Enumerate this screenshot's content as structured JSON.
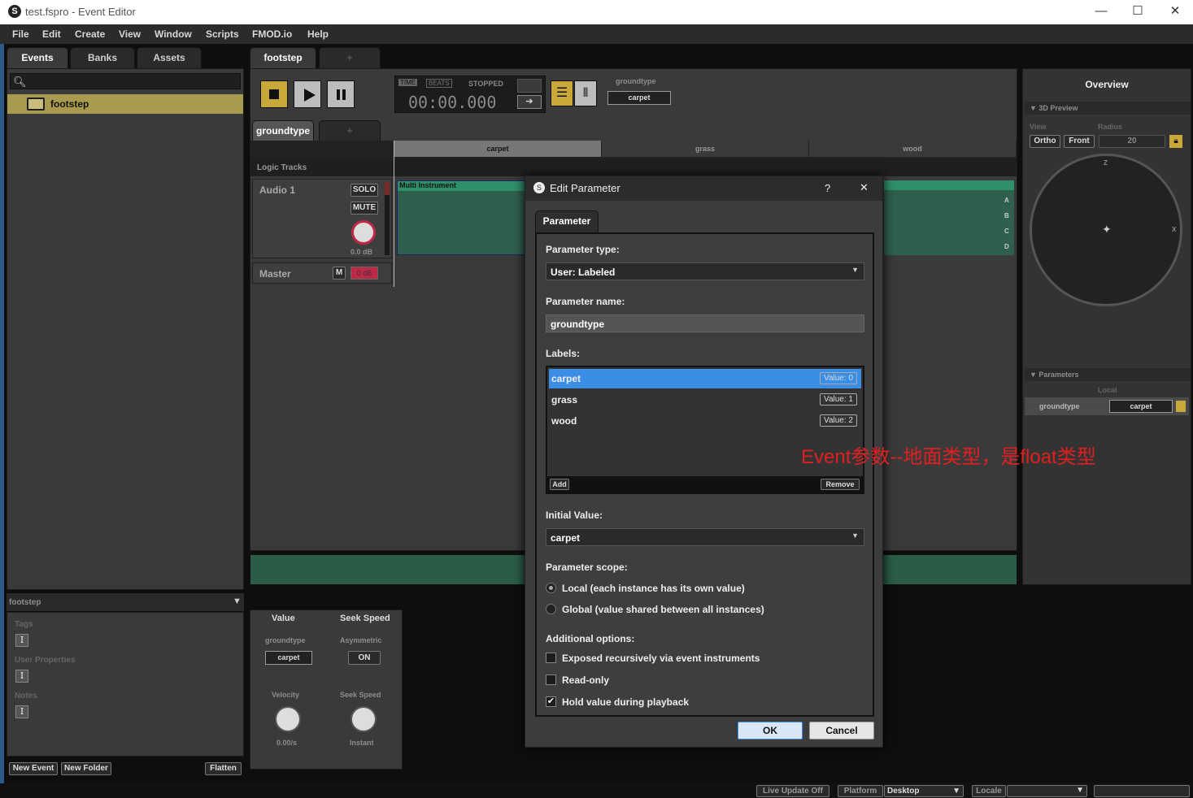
{
  "window": {
    "title": "test.fspro - Event Editor",
    "min": "—",
    "max": "☐",
    "close": "✕"
  },
  "menu": [
    "File",
    "Edit",
    "Create",
    "View",
    "Window",
    "Scripts",
    "FMOD.io",
    "Help"
  ],
  "left": {
    "tabs": [
      "Events",
      "Banks",
      "Assets"
    ],
    "search_placeholder": "",
    "event_item": "footstep",
    "props_header": "footstep",
    "tags_label": "Tags",
    "user_props_label": "User Properties",
    "notes_label": "Notes",
    "new_event": "New Event",
    "new_folder": "New Folder",
    "flatten": "Flatten"
  },
  "editor": {
    "tab": "footstep",
    "tab_add": "+",
    "time_label": "TIME",
    "beats_label": "BEATS",
    "status": "STOPPED",
    "time": "00:00.000",
    "param_name": "groundtype",
    "param_value": "carpet",
    "param_tab": "groundtype",
    "labels": [
      "carpet",
      "grass",
      "wood"
    ],
    "logic_tracks": "Logic Tracks",
    "audio_track": "Audio 1",
    "solo": "SOLO",
    "mute": "MUTE",
    "db": "0.0 dB",
    "multi": "Multi Instrument",
    "master": "Master",
    "master_m": "M",
    "master_db": "0 dB",
    "slots": [
      "A",
      "B",
      "C",
      "D"
    ]
  },
  "deck": {
    "value_header": "Value",
    "seek_header": "Seek Speed",
    "groundtype": "groundtype",
    "carpet": "carpet",
    "asymmetric": "Asymmetric",
    "on": "ON",
    "velocity": "Velocity",
    "velocity_val": "0.00/s",
    "seek_speed": "Seek Speed",
    "seek_val": "Instant"
  },
  "overview": {
    "title": "Overview",
    "preview_3d": "3D Preview",
    "view": "View",
    "radius": "Radius",
    "ortho": "Ortho",
    "front": "Front",
    "radius_val": "20",
    "z": "Z",
    "x": "X",
    "parameters": "Parameters",
    "local": "Local",
    "param_name": "groundtype",
    "param_value": "carpet"
  },
  "dialog": {
    "title": "Edit Parameter",
    "help": "?",
    "close": "✕",
    "tab": "Parameter",
    "type_label": "Parameter type:",
    "type_value": "User: Labeled",
    "name_label": "Parameter name:",
    "name_value": "groundtype",
    "labels_label": "Labels:",
    "labels": [
      {
        "name": "carpet",
        "value": "Value: 0"
      },
      {
        "name": "grass",
        "value": "Value: 1"
      },
      {
        "name": "wood",
        "value": "Value: 2"
      }
    ],
    "add": "Add",
    "remove": "Remove",
    "initial_label": "Initial Value:",
    "initial_value": "carpet",
    "scope_label": "Parameter scope:",
    "scope_local": "Local (each instance has its own value)",
    "scope_global": "Global (value shared between all instances)",
    "options_label": "Additional options:",
    "opt1": "Exposed recursively via event instruments",
    "opt2": "Read-only",
    "opt3": "Hold value during playback",
    "ok": "OK",
    "cancel": "Cancel"
  },
  "annotation": "Event参数--地面类型，是float类型",
  "statusbar": {
    "live_update": "Live Update Off",
    "platform": "Platform",
    "platform_val": "Desktop",
    "locale": "Locale"
  },
  "colors": {
    "accent": "#3a8ee6",
    "track": "#2f8f6a",
    "annotation": "#e02020",
    "selection": "#a89a4e"
  }
}
